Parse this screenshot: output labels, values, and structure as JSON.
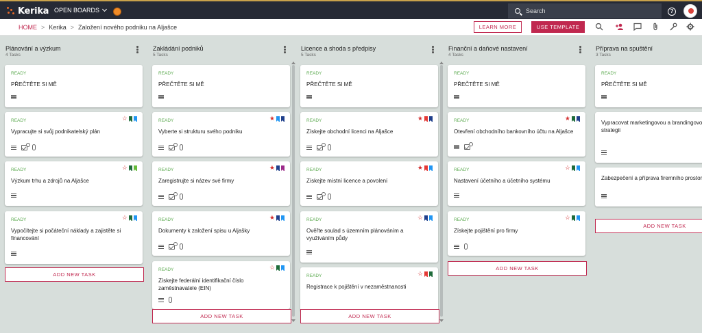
{
  "app": {
    "logo": "Kerika",
    "open_boards": "OPEN BOARDS",
    "search_placeholder": "Search",
    "help": "?"
  },
  "breadcrumb": {
    "home": "HOME",
    "sep": ">",
    "org": "Kerika",
    "board": "Založení nového podniku na Aljašce"
  },
  "toolbar": {
    "learn_more": "LEARN MORE",
    "use_template": "USE TEMPLATE"
  },
  "columns": [
    {
      "title": "Plánování a výzkum",
      "count": "4 Tasks",
      "add_label": "ADD NEW TASK",
      "cards": [
        {
          "status": "READY",
          "title": "PŘEČTĚTE SI MĚ",
          "icons": [
            "desc"
          ],
          "star": "",
          "flags": []
        },
        {
          "status": "READY",
          "title": "Vypracujte si svůj podnikatelský plán",
          "icons": [
            "desc",
            "check",
            "clip"
          ],
          "star": "outline",
          "flags": [
            "#1f6b3a",
            "#2196f3"
          ]
        },
        {
          "status": "READY",
          "title": "Výzkum trhu a zdrojů na Aljašce",
          "icons": [
            "desc"
          ],
          "star": "outline",
          "flags": [
            "#1f6b3a",
            "#66bb3a"
          ]
        },
        {
          "status": "READY",
          "title": "Vypočítejte si počáteční náklady a zajistěte si financování",
          "icons": [
            "desc"
          ],
          "star": "outline",
          "flags": [
            "#1f6b3a",
            "#2196f3"
          ]
        }
      ]
    },
    {
      "title": "Zakládání podniků",
      "count": "5 Tasks",
      "add_label": "ADD NEW TASK",
      "cards": [
        {
          "status": "READY",
          "title": "PŘEČTĚTE SI MĚ",
          "icons": [
            "desc"
          ],
          "star": "",
          "flags": []
        },
        {
          "status": "READY",
          "title": "Vyberte si strukturu svého podniku",
          "icons": [
            "desc",
            "check",
            "clip"
          ],
          "star": "solid",
          "flags": [
            "#2196f3",
            "#1f3f8b"
          ]
        },
        {
          "status": "READY",
          "title": "Zaregistrujte si název své firmy",
          "icons": [
            "desc",
            "check",
            "clip"
          ],
          "star": "solid",
          "flags": [
            "#1f3f8b",
            "#9c2a8a"
          ]
        },
        {
          "status": "READY",
          "title": "Dokumenty k založení spisu u Aljašky",
          "icons": [
            "desc",
            "check",
            "clip"
          ],
          "star": "solid",
          "flags": [
            "#1f3f8b",
            "#2196f3"
          ]
        },
        {
          "status": "READY",
          "title": "Získejte federální identifikační číslo zaměstnavatele (EIN)",
          "icons": [
            "desc",
            "clip"
          ],
          "star": "outline",
          "flags": [
            "#1f6b3a",
            "#2196f3"
          ]
        }
      ]
    },
    {
      "title": "Licence a shoda s předpisy",
      "count": "5 Tasks",
      "add_label": "ADD NEW TASK",
      "cards": [
        {
          "status": "READY",
          "title": "PŘEČTĚTE SI MĚ",
          "icons": [
            "desc"
          ],
          "star": "",
          "flags": []
        },
        {
          "status": "READY",
          "title": "Získejte obchodní licenci na Aljašce",
          "icons": [
            "desc",
            "check",
            "clip"
          ],
          "star": "solid",
          "flags": [
            "#e53935",
            "#1f3f8b"
          ]
        },
        {
          "status": "READY",
          "title": "Získejte místní licence a povolení",
          "icons": [
            "desc",
            "check",
            "clip"
          ],
          "star": "solid",
          "flags": [
            "#e53935",
            "#2196f3"
          ]
        },
        {
          "status": "READY",
          "title": "Ověřte soulad s územním plánováním a využíváním půdy",
          "icons": [
            "desc"
          ],
          "star": "outline",
          "flags": [
            "#1f3f8b",
            "#2196f3"
          ]
        },
        {
          "status": "READY",
          "title": "Registrace k pojištění v nezaměstnanosti",
          "icons": [],
          "star": "outline",
          "flags": [
            "#e53935",
            "#1f6b3a"
          ]
        }
      ]
    },
    {
      "title": "Finanční a daňové nastavení",
      "count": "4 Tasks",
      "add_label": "ADD NEW TASK",
      "cards": [
        {
          "status": "READY",
          "title": "PŘEČTĚTE SI MĚ",
          "icons": [
            "desc"
          ],
          "star": "",
          "flags": []
        },
        {
          "status": "READY",
          "title": "Otevření obchodního bankovního účtu na Aljašce",
          "icons": [
            "desc",
            "check"
          ],
          "star": "solid",
          "flags": [
            "#1f6b3a",
            "#1f3f8b"
          ]
        },
        {
          "status": "READY",
          "title": "Nastavení účetního a účetního systému",
          "icons": [
            "desc"
          ],
          "star": "outline",
          "flags": [
            "#1f6b3a",
            "#2196f3"
          ]
        },
        {
          "status": "READY",
          "title": "Získejte pojištění pro firmy",
          "icons": [
            "desc",
            "clip"
          ],
          "star": "outline",
          "flags": [
            "#1f6b3a",
            "#2196f3"
          ]
        }
      ]
    },
    {
      "title": "Příprava na spuštění",
      "count": "3 Tasks",
      "add_label": "ADD NEW TASK",
      "cards": [
        {
          "status": "READY",
          "title": "PŘEČTĚTE SI MĚ",
          "icons": [
            "desc"
          ],
          "star": "",
          "flags": []
        },
        {
          "status": "",
          "title": "Vypracovat marketingovou a brandingovou strategii",
          "icons": [
            "desc"
          ],
          "star": "",
          "flags": []
        },
        {
          "status": "",
          "title": "Zabezpečení a příprava firemního prostoru",
          "icons": [
            "desc"
          ],
          "star": "",
          "flags": []
        }
      ]
    }
  ]
}
